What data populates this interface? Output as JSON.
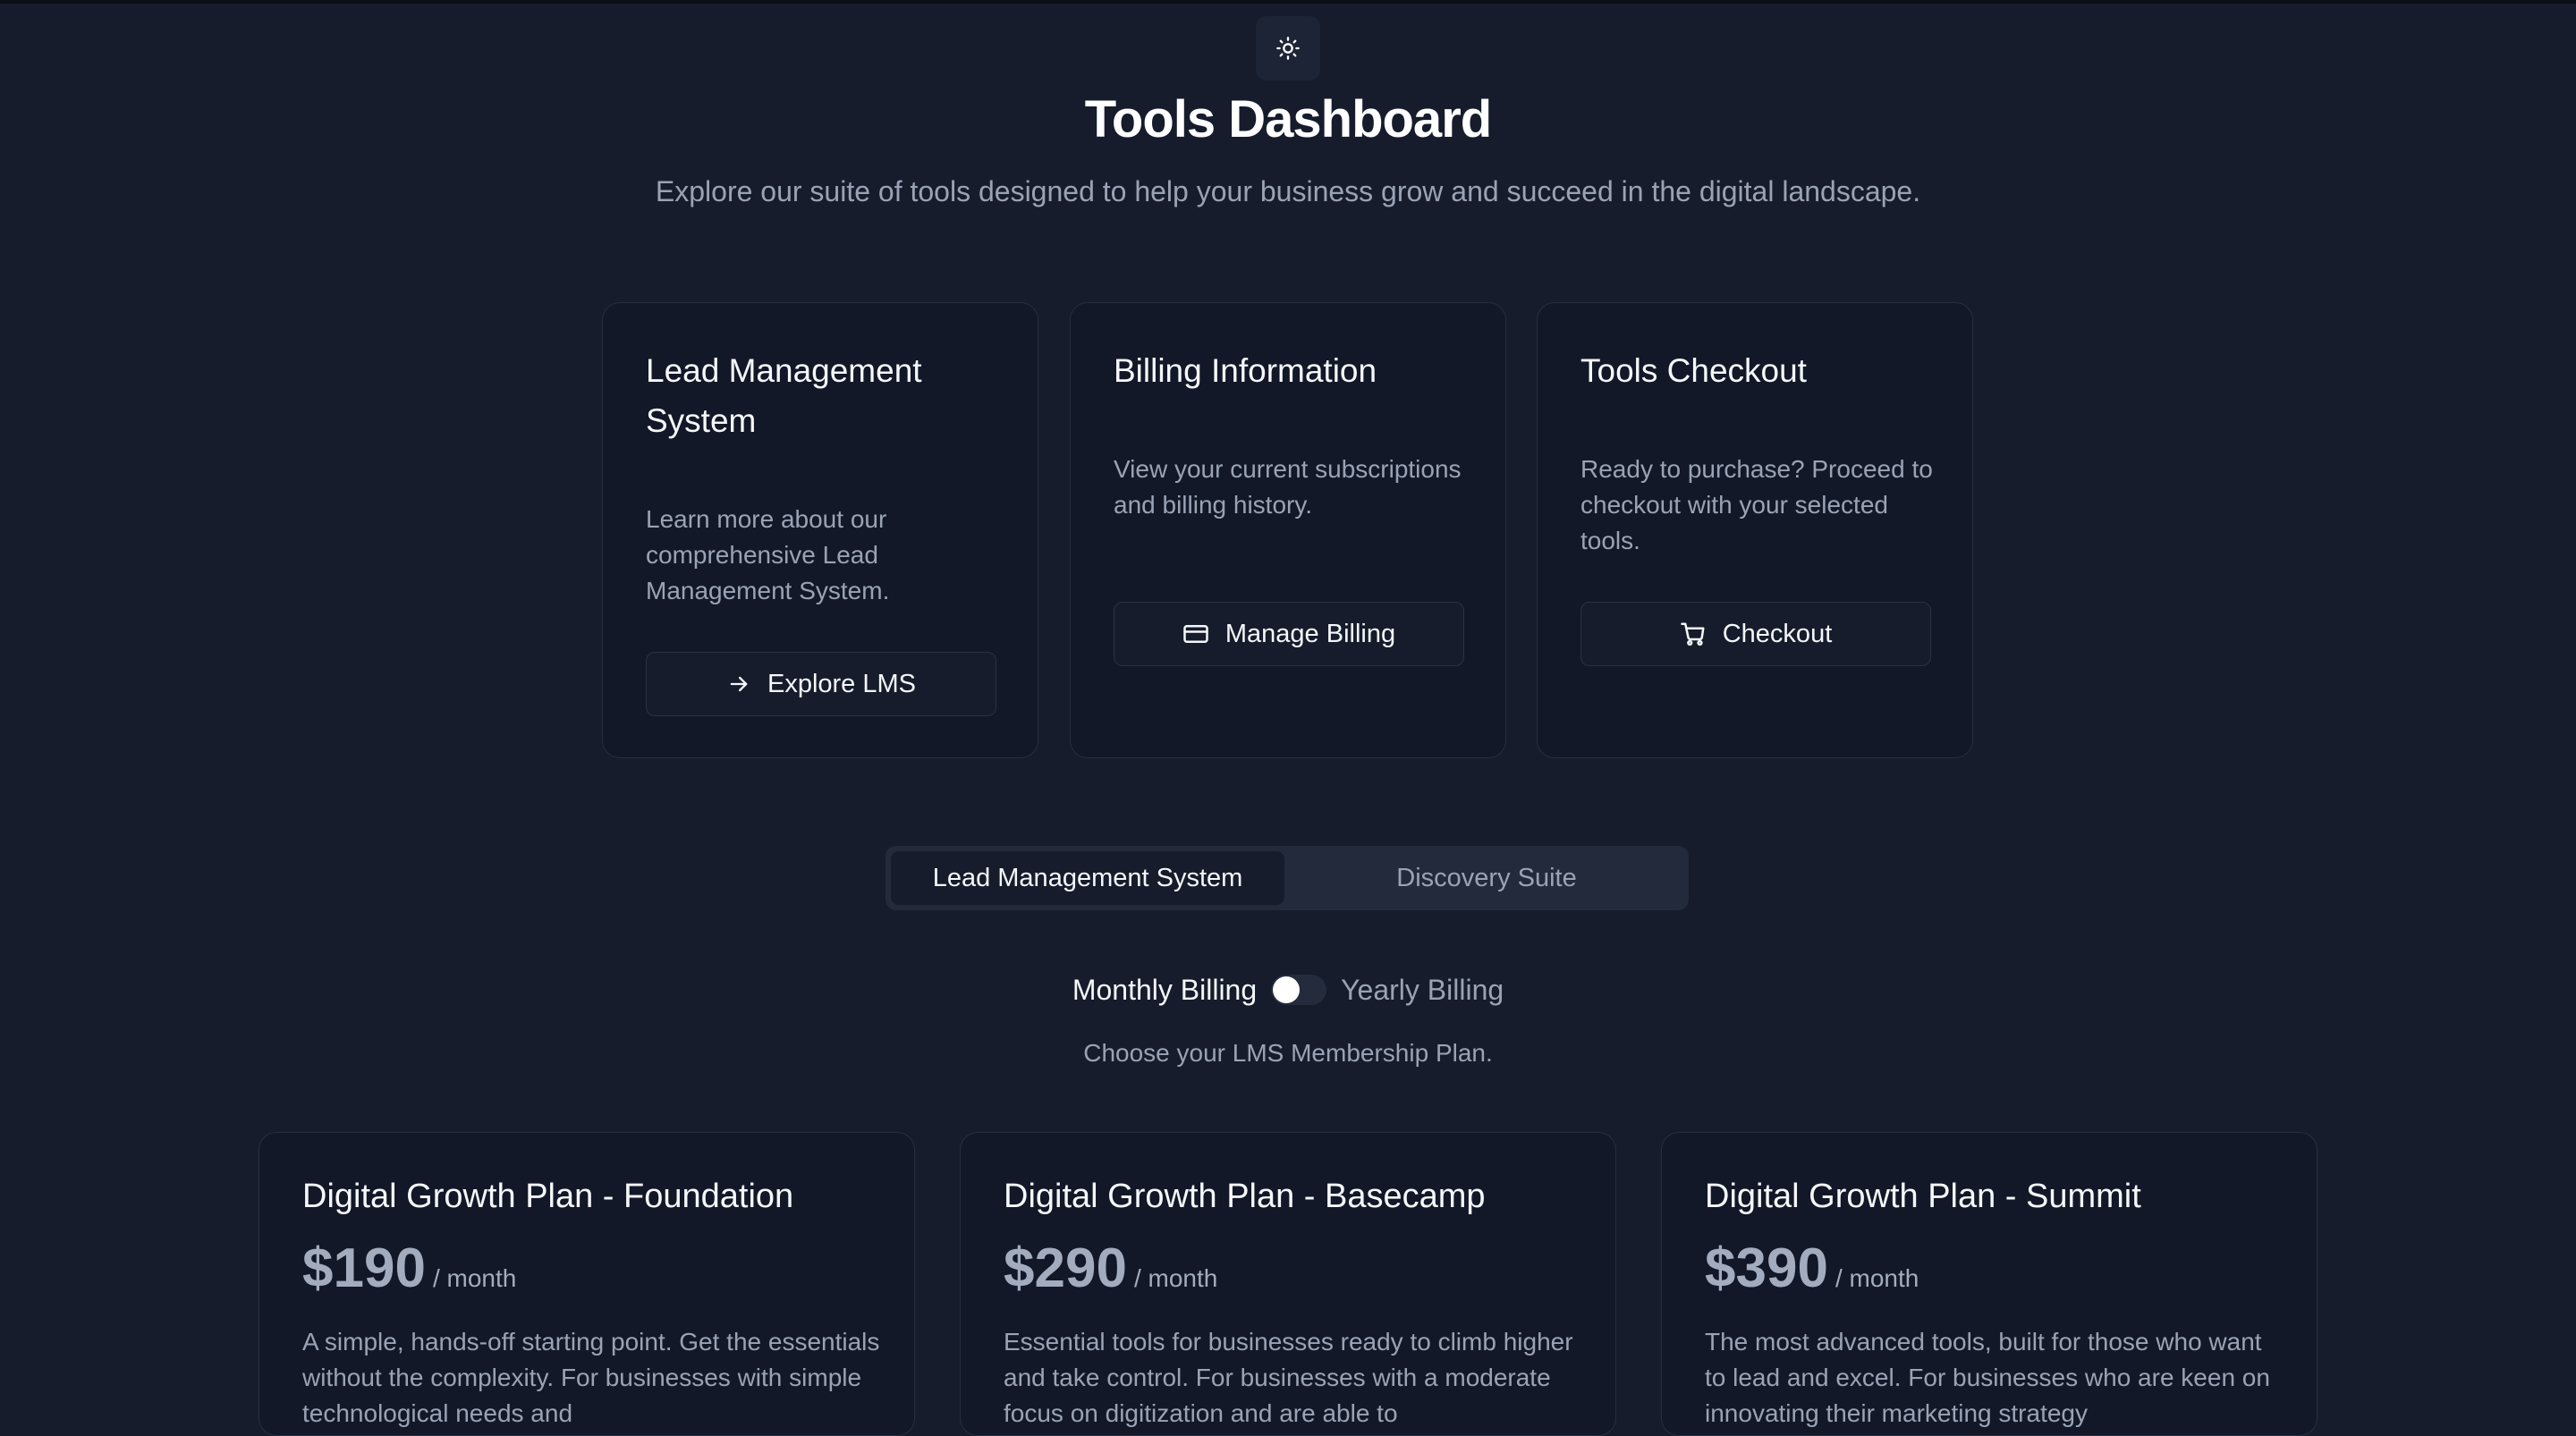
{
  "header": {
    "title": "Tools Dashboard",
    "subtitle": "Explore our suite of tools designed to help your business grow and succeed in the digital landscape.",
    "theme_icon": "sun-icon"
  },
  "tools": [
    {
      "title": "Lead Management System",
      "description": "Learn more about our comprehensive Lead Management System.",
      "button": "Explore LMS",
      "icon": "arrow-right-icon"
    },
    {
      "title": "Billing Information",
      "description": "View your current subscriptions and billing history.",
      "button": "Manage Billing",
      "icon": "credit-card-icon"
    },
    {
      "title": "Tools Checkout",
      "description": "Ready to purchase? Proceed to checkout with your selected tools.",
      "button": "Checkout",
      "icon": "shopping-cart-icon"
    }
  ],
  "tabs": [
    {
      "label": "Lead Management System",
      "active": true
    },
    {
      "label": "Discovery Suite",
      "active": false
    }
  ],
  "billing": {
    "monthly_label": "Monthly Billing",
    "yearly_label": "Yearly Billing",
    "selected": "monthly"
  },
  "plan_prompt": "Choose your LMS Membership Plan.",
  "plans": [
    {
      "name": "Digital Growth Plan - Foundation",
      "price": "$190",
      "period": "/ month",
      "description": "A simple, hands-off starting point. Get the essentials without the complexity. For businesses with simple technological needs and"
    },
    {
      "name": "Digital Growth Plan - Basecamp",
      "price": "$290",
      "period": "/ month",
      "description": "Essential tools for businesses ready to climb higher and take control. For businesses with a moderate focus on digitization and are able to"
    },
    {
      "name": "Digital Growth Plan - Summit",
      "price": "$390",
      "period": "/ month",
      "description": "The most advanced tools, built for those who want to lead and excel. For businesses who are keen on innovating their marketing strategy"
    }
  ],
  "colors": {
    "background": "#161c2c",
    "card": "#121828",
    "border": "#262e42",
    "text": "#f5f7fa",
    "muted": "#9aa3b5"
  }
}
